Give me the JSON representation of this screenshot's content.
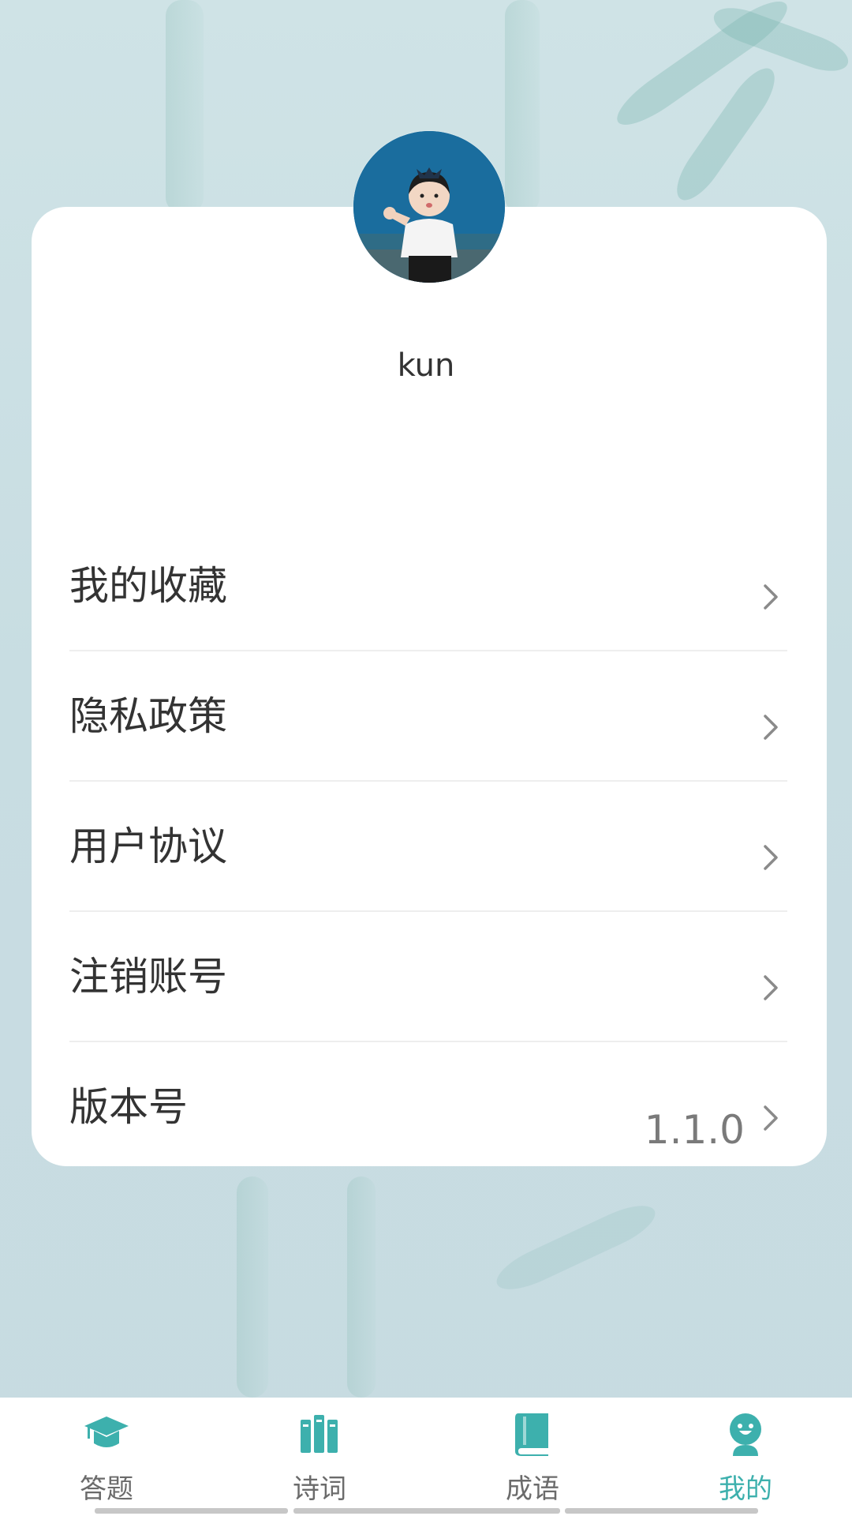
{
  "profile": {
    "username": "kun"
  },
  "menu": {
    "items": [
      {
        "label": "我的收藏",
        "value": ""
      },
      {
        "label": "隐私政策",
        "value": ""
      },
      {
        "label": "用户协议",
        "value": ""
      },
      {
        "label": "注销账号",
        "value": ""
      },
      {
        "label": "版本号",
        "value": "1.1.0"
      }
    ]
  },
  "tabbar": {
    "tabs": [
      {
        "label": "答题",
        "icon": "graduation-cap-icon"
      },
      {
        "label": "诗词",
        "icon": "books-icon"
      },
      {
        "label": "成语",
        "icon": "book-icon"
      },
      {
        "label": "我的",
        "icon": "user-icon"
      }
    ],
    "active_index": 3
  },
  "colors": {
    "accent": "#3db0ad",
    "background": "#cfe3e6",
    "card": "#ffffff",
    "text": "#333333",
    "muted": "#7a7a7a"
  }
}
